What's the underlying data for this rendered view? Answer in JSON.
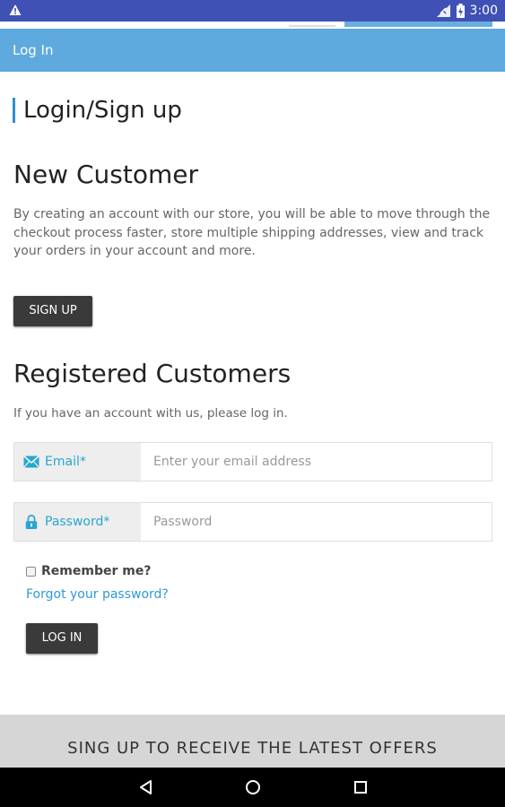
{
  "status_bar": {
    "time": "3:00"
  },
  "header": {
    "title": "Log In"
  },
  "page": {
    "title": "Login/Sign up"
  },
  "new_customer": {
    "heading": "New Customer",
    "description": "By creating an account with our store, you will be able to move through the checkout process faster, store multiple shipping addresses, view and track your orders in your account and more.",
    "button": "SIGN UP"
  },
  "registered": {
    "heading": "Registered Customers",
    "subtitle": "If you have an account with us, please log in.",
    "email": {
      "label": "Email*",
      "placeholder": "Enter your email address",
      "value": ""
    },
    "password": {
      "label": "Password*",
      "placeholder": "Password",
      "value": ""
    },
    "remember": "Remember me?",
    "forgot": "Forgot your password?",
    "button": "LOG IN"
  },
  "newsletter": {
    "text": "SING UP TO RECEIVE THE LATEST OFFERS"
  },
  "colors": {
    "accent": "#5ea9de",
    "status_bar": "#3f51b5",
    "link": "#2e9ad8",
    "button": "#3a3a3a"
  }
}
